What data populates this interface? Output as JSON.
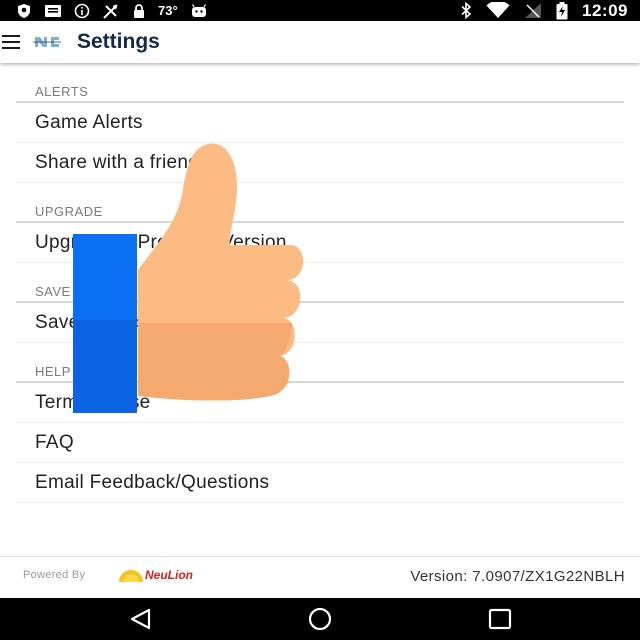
{
  "status_bar": {
    "left_icons": [
      "shield-icon",
      "message-icon",
      "info-icon",
      "fantasy-sports-icon",
      "lock-icon"
    ],
    "temperature": "73°",
    "right_icons": [
      "bluetooth-icon",
      "wifi-icon",
      "no-signal-icon",
      "battery-charging-icon"
    ],
    "time": "12:09"
  },
  "app_bar": {
    "title": "Settings",
    "menu_icon": "menu-icon",
    "logo_icon": "team-logo-icon"
  },
  "sections": [
    {
      "header": "ALERTS",
      "items": [
        "Game Alerts",
        "Share with a friend"
      ]
    },
    {
      "header": "UPGRADE",
      "items": [
        "Upgrade to Premium Version"
      ]
    },
    {
      "header": "SAVE",
      "items": [
        "Save Photos"
      ]
    },
    {
      "header": "HELP",
      "items": [
        "Terms of Use",
        "FAQ",
        "Email Feedback/Questions"
      ]
    }
  ],
  "footer": {
    "powered_by": "Powered By",
    "brand": "NeuLion",
    "version": "Version: 7.0907/ZX1G22NBLH"
  },
  "nav_bar": {
    "buttons": [
      "back-icon",
      "home-icon",
      "recents-icon"
    ]
  },
  "colors": {
    "title": "#13294b",
    "section_header": "#7a7a7a",
    "overlay_blue": "#0a6ff0",
    "thumb_skin": "#f7b47c"
  }
}
